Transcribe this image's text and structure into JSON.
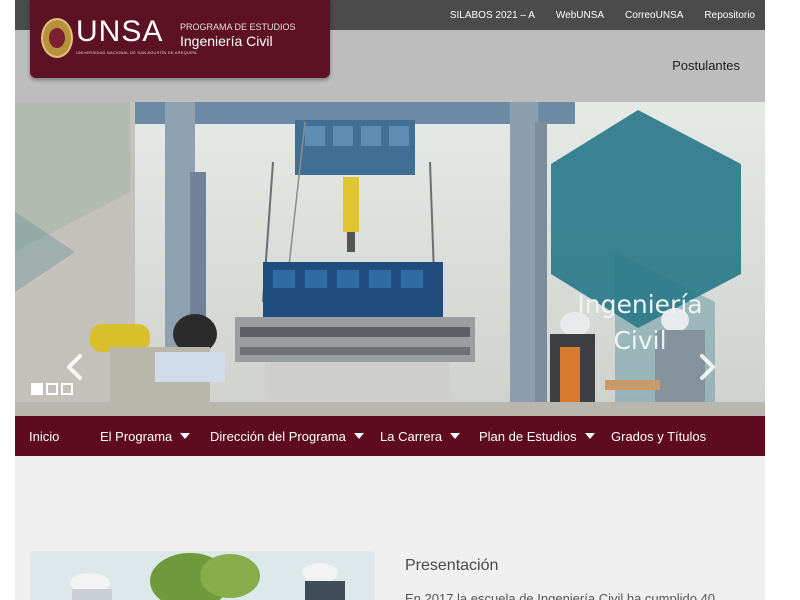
{
  "topbar": {
    "links": [
      "SILABOS 2021 – A",
      "WebUNSA",
      "CorreoUNSA",
      "Repositorio"
    ]
  },
  "header": {
    "logo_text": "UNSA",
    "logo_subtext": "UNIVERSIDAD NACIONAL DE SAN AGUSTÍN DE AREQUIPA",
    "program_label": "PROGRAMA DE ESTUDIOS",
    "program_name": "Ingeniería Civil",
    "postulantes": "Postulantes"
  },
  "hero": {
    "title_line1": "Ingeniería",
    "title_line2": "Civil",
    "prev_icon": "chevron-left-icon",
    "next_icon": "chevron-right-icon",
    "slides": 3,
    "active_slide": 1
  },
  "nav": {
    "items": [
      {
        "label": "Inicio",
        "has_dropdown": false
      },
      {
        "label": "El Programa",
        "has_dropdown": true
      },
      {
        "label": "Dirección del Programa",
        "has_dropdown": true
      },
      {
        "label": "La Carrera",
        "has_dropdown": true
      },
      {
        "label": "Plan de Estudios",
        "has_dropdown": true
      },
      {
        "label": "Grados y Títulos",
        "has_dropdown": false
      }
    ]
  },
  "content": {
    "section_title": "Presentación",
    "section_text": "En 2017 la escuela de Ingeniería Civil ha cumplido 40"
  },
  "colors": {
    "brand": "#5e0b1f",
    "topbar": "#4b4b4b",
    "header": "#bdbdbd",
    "hex": "#2f7c8c"
  }
}
